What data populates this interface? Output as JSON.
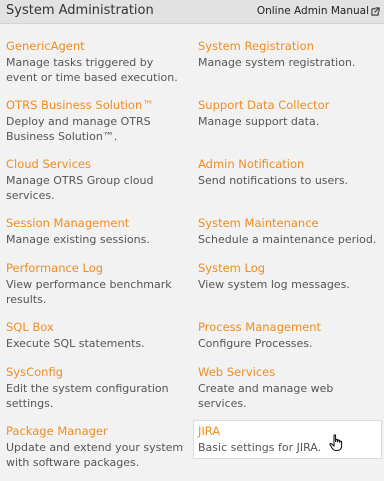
{
  "header": {
    "title": "System Administration",
    "manual_link": "Online Admin Manual",
    "manual_icon": "external-link-icon"
  },
  "items": [
    {
      "title": "GenericAgent",
      "desc": "Manage tasks triggered by event or time based execution."
    },
    {
      "title": "System Registration",
      "desc": "Manage system registration."
    },
    {
      "title": "OTRS Business Solution™",
      "desc": "Deploy and manage OTRS Business Solution™."
    },
    {
      "title": "Support Data Collector",
      "desc": "Manage support data."
    },
    {
      "title": "Cloud Services",
      "desc": "Manage OTRS Group cloud services."
    },
    {
      "title": "Admin Notification",
      "desc": "Send notifications to users."
    },
    {
      "title": "Session Management",
      "desc": "Manage existing sessions."
    },
    {
      "title": "System Maintenance",
      "desc": "Schedule a maintenance period."
    },
    {
      "title": "Performance Log",
      "desc": "View performance benchmark results."
    },
    {
      "title": "System Log",
      "desc": "View system log messages."
    },
    {
      "title": "SQL Box",
      "desc": "Execute SQL statements."
    },
    {
      "title": "Process Management",
      "desc": "Configure Processes."
    },
    {
      "title": "SysConfig",
      "desc": "Edit the system configuration settings."
    },
    {
      "title": "Web Services",
      "desc": "Create and manage web services."
    },
    {
      "title": "Package Manager",
      "desc": "Update and extend your system with software packages."
    },
    {
      "title": "JIRA",
      "desc": "Basic settings for JIRA."
    }
  ],
  "colors": {
    "link": "#f28c1d",
    "text": "#555555",
    "header_bg": "#e2e2e2",
    "panel_bg": "#f2f2f2"
  },
  "cursor_icon": "hand-pointer-icon"
}
